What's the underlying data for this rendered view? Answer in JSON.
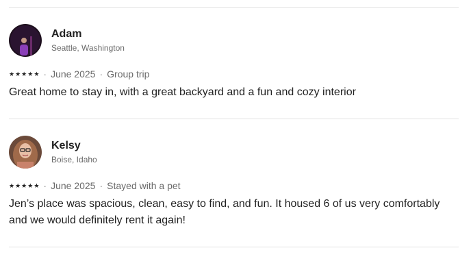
{
  "reviews": [
    {
      "name": "Adam",
      "location": "Seattle, Washington",
      "rating": 5,
      "date": "June 2025",
      "trip_type": "Group trip",
      "text": "Great home to stay in, with a great backyard and a fun and cozy interior",
      "avatar_icon": "person-photo-avatar"
    },
    {
      "name": "Kelsy",
      "location": "Boise, Idaho",
      "rating": 5,
      "date": "June 2025",
      "trip_type": "Stayed with a pet",
      "text": "Jen’s place was spacious, clean, easy to find, and fun. It housed 6 of us very comfortably and we would definitely rent it again!",
      "avatar_icon": "person-photo-avatar"
    }
  ],
  "separator": "·",
  "star_glyph": "★",
  "colors": {
    "text": "#222222",
    "muted": "#6a6a6a",
    "divider": "#e3e3e3"
  }
}
